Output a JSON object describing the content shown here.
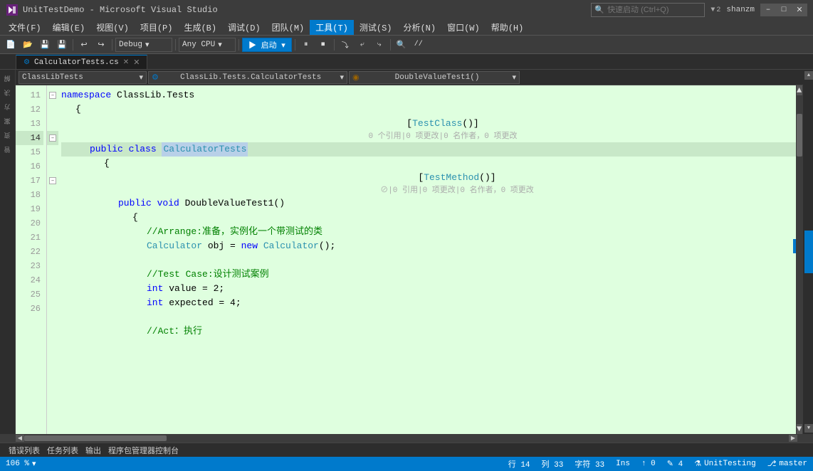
{
  "title_bar": {
    "icon": "▶",
    "text": "UnitTestDemo - Microsoft Visual Studio",
    "search_placeholder": "快速启动 (Ctrl+Q)",
    "notification_count": "2",
    "minimize": "–",
    "maximize": "□",
    "close": "✕",
    "user": "shanzm"
  },
  "menu": {
    "items": [
      {
        "label": "文件(F)"
      },
      {
        "label": "编辑(E)"
      },
      {
        "label": "视图(V)"
      },
      {
        "label": "项目(P)"
      },
      {
        "label": "生成(B)"
      },
      {
        "label": "调试(D)"
      },
      {
        "label": "团队(M)"
      },
      {
        "label": "工具(T)",
        "active": true
      },
      {
        "label": "测试(S)"
      },
      {
        "label": "分析(N)"
      },
      {
        "label": "窗口(W)"
      },
      {
        "label": "帮助(H)"
      }
    ]
  },
  "toolbar": {
    "debug_config": "Debug",
    "cpu_config": "Any CPU",
    "start_label": "▶ 启动 ▾"
  },
  "tabs": {
    "active_tab": "CalculatorTests.cs",
    "active_modified": false
  },
  "editor_nav": {
    "class_selector": "ClassLibTests",
    "namespace_selector": "ClassLib.Tests.CalculatorTests",
    "method_selector": "DoubleValueTest1()"
  },
  "code": {
    "lines": [
      {
        "num": "11",
        "indent": 0,
        "collapse": true,
        "content": "namespace",
        "rest": " ClassLib.Tests"
      },
      {
        "num": "12",
        "indent": 1,
        "content": "{"
      },
      {
        "num": "13",
        "indent": 2,
        "content": "[TestClass()]",
        "hint": "0 个引用|0 项更改|0 名作者，0 项更改"
      },
      {
        "num": "14",
        "indent": 2,
        "collapse": true,
        "content": "public class CalculatorTests",
        "highlight_word": "CalculatorTests"
      },
      {
        "num": "15",
        "indent": 3,
        "content": "{"
      },
      {
        "num": "16",
        "indent": 4,
        "content": "[TestMethod()]",
        "hint": "⊘|0 引用|0 项更改|0 名作者，0 项更改"
      },
      {
        "num": "17",
        "indent": 4,
        "collapse": true,
        "content": "public void DoubleValueTest1()"
      },
      {
        "num": "18",
        "indent": 5,
        "content": "{"
      },
      {
        "num": "19",
        "indent": 6,
        "content": "//Arrange:准备，实例化一个带测试的类"
      },
      {
        "num": "20",
        "indent": 6,
        "content": "Calculator obj = new Calculator();",
        "has_indicator": true
      },
      {
        "num": "21",
        "indent": 6,
        "content": ""
      },
      {
        "num": "22",
        "indent": 6,
        "content": "//Test Case:设计测试案例"
      },
      {
        "num": "23",
        "indent": 6,
        "content": "int value = 2;"
      },
      {
        "num": "24",
        "indent": 6,
        "content": "int expected = 4;"
      },
      {
        "num": "25",
        "indent": 6,
        "content": ""
      },
      {
        "num": "26",
        "indent": 6,
        "content": "//Act：执行"
      }
    ]
  },
  "bottom_tabs": [
    {
      "label": "错误列表",
      "active": false
    },
    {
      "label": "任务列表",
      "active": false
    },
    {
      "label": "输出",
      "active": false
    },
    {
      "label": "程序包管理器控制台",
      "active": false
    }
  ],
  "status_bar": {
    "zoom": "106 %",
    "row_label": "行 14",
    "col_label": "列 33",
    "char_label": "字符 33",
    "ins_label": "Ins",
    "up_arrow": "↑ 0",
    "pencil": "✎ 4",
    "unit_testing": "UnitTesting",
    "branch_icon": "⎇",
    "branch": "master"
  }
}
